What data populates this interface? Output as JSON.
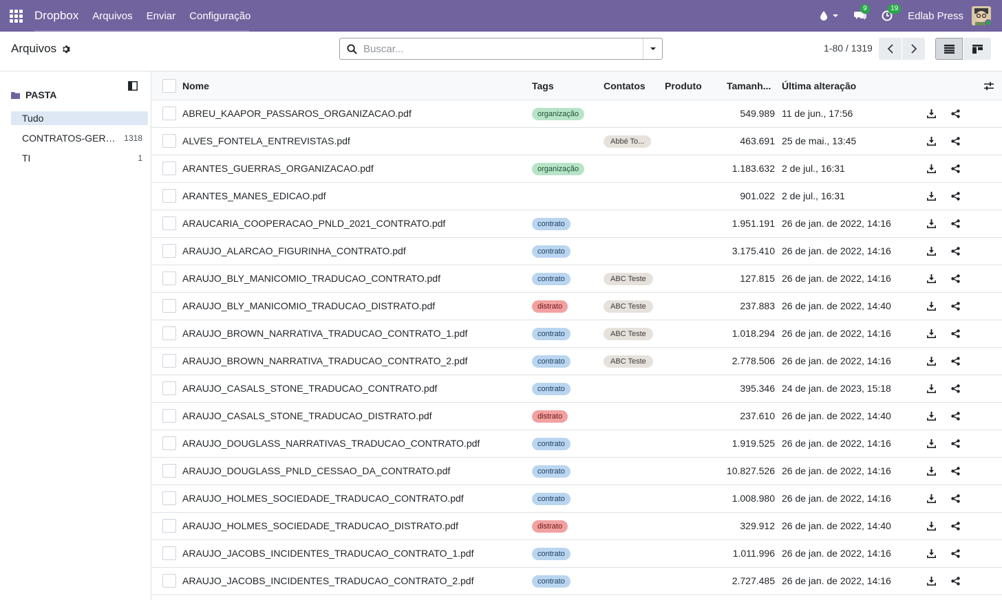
{
  "navbar": {
    "brand": "Dropbox",
    "menu": [
      "Arquivos",
      "Enviar",
      "Configuração"
    ],
    "messages_badge": "9",
    "activities_badge": "19",
    "username": "Edlab Press"
  },
  "control": {
    "title": "Arquivos",
    "search_placeholder": "Buscar...",
    "pager": "1-80 / 1319"
  },
  "sidebar": {
    "heading": "PASTA",
    "items": [
      {
        "label": "Tudo",
        "count": ""
      },
      {
        "label": "CONTRATOS-GERAIS",
        "count": "1318"
      },
      {
        "label": "TI",
        "count": "1"
      }
    ]
  },
  "table": {
    "headers": {
      "name": "Nome",
      "tags": "Tags",
      "contacts": "Contatos",
      "product": "Produto",
      "size": "Tamanh...",
      "modified": "Última alteração"
    },
    "rows": [
      {
        "name": "ABREU_KAAPOR_PASSAROS_ORGANIZACAO.pdf",
        "tag": "organização",
        "tag_color": "green",
        "contact": "",
        "size": "549.989",
        "date": "11 de jun., 17:56"
      },
      {
        "name": "ALVES_FONTELA_ENTREVISTAS.pdf",
        "tag": "",
        "tag_color": "",
        "contact": "Abbé To...",
        "size": "463.691",
        "date": "25 de mai., 13:45"
      },
      {
        "name": "ARANTES_GUERRAS_ORGANIZACAO.pdf",
        "tag": "organização",
        "tag_color": "green",
        "contact": "",
        "size": "1.183.632",
        "date": "2 de jul., 16:31"
      },
      {
        "name": "ARANTES_MANES_EDICAO.pdf",
        "tag": "",
        "tag_color": "",
        "contact": "",
        "size": "901.022",
        "date": "2 de jul., 16:31"
      },
      {
        "name": "ARAUCARIA_COOPERACAO_PNLD_2021_CONTRATO.pdf",
        "tag": "contrato",
        "tag_color": "blue",
        "contact": "",
        "size": "1.951.191",
        "date": "26 de jan. de 2022, 14:16"
      },
      {
        "name": "ARAUJO_ALARCAO_FIGURINHA_CONTRATO.pdf",
        "tag": "contrato",
        "tag_color": "blue",
        "contact": "",
        "size": "3.175.410",
        "date": "26 de jan. de 2022, 14:16"
      },
      {
        "name": "ARAUJO_BLY_MANICOMIO_TRADUCAO_CONTRATO.pdf",
        "tag": "contrato",
        "tag_color": "blue",
        "contact": "ABC Teste",
        "size": "127.815",
        "date": "26 de jan. de 2022, 14:16"
      },
      {
        "name": "ARAUJO_BLY_MANICOMIO_TRADUCAO_DISTRATO.pdf",
        "tag": "distrato",
        "tag_color": "red",
        "contact": "ABC Teste",
        "size": "237.883",
        "date": "26 de jan. de 2022, 14:40"
      },
      {
        "name": "ARAUJO_BROWN_NARRATIVA_TRADUCAO_CONTRATO_1.pdf",
        "tag": "contrato",
        "tag_color": "blue",
        "contact": "ABC Teste",
        "size": "1.018.294",
        "date": "26 de jan. de 2022, 14:16"
      },
      {
        "name": "ARAUJO_BROWN_NARRATIVA_TRADUCAO_CONTRATO_2.pdf",
        "tag": "contrato",
        "tag_color": "blue",
        "contact": "ABC Teste",
        "size": "2.778.506",
        "date": "26 de jan. de 2022, 14:16"
      },
      {
        "name": "ARAUJO_CASALS_STONE_TRADUCAO_CONTRATO.pdf",
        "tag": "contrato",
        "tag_color": "blue",
        "contact": "",
        "size": "395.346",
        "date": "24 de jan. de 2023, 15:18"
      },
      {
        "name": "ARAUJO_CASALS_STONE_TRADUCAO_DISTRATO.pdf",
        "tag": "distrato",
        "tag_color": "red",
        "contact": "",
        "size": "237.610",
        "date": "26 de jan. de 2022, 14:40"
      },
      {
        "name": "ARAUJO_DOUGLASS_NARRATIVAS_TRADUCAO_CONTRATO.pdf",
        "tag": "contrato",
        "tag_color": "blue",
        "contact": "",
        "size": "1.919.525",
        "date": "26 de jan. de 2022, 14:16"
      },
      {
        "name": "ARAUJO_DOUGLASS_PNLD_CESSAO_DA_CONTRATO.pdf",
        "tag": "contrato",
        "tag_color": "blue",
        "contact": "",
        "size": "10.827.526",
        "date": "26 de jan. de 2022, 14:16"
      },
      {
        "name": "ARAUJO_HOLMES_SOCIEDADE_TRADUCAO_CONTRATO.pdf",
        "tag": "contrato",
        "tag_color": "blue",
        "contact": "",
        "size": "1.008.980",
        "date": "26 de jan. de 2022, 14:16"
      },
      {
        "name": "ARAUJO_HOLMES_SOCIEDADE_TRADUCAO_DISTRATO.pdf",
        "tag": "distrato",
        "tag_color": "red",
        "contact": "",
        "size": "329.912",
        "date": "26 de jan. de 2022, 14:40"
      },
      {
        "name": "ARAUJO_JACOBS_INCIDENTES_TRADUCAO_CONTRATO_1.pdf",
        "tag": "contrato",
        "tag_color": "blue",
        "contact": "",
        "size": "1.011.996",
        "date": "26 de jan. de 2022, 14:16"
      },
      {
        "name": "ARAUJO_JACOBS_INCIDENTES_TRADUCAO_CONTRATO_2.pdf",
        "tag": "contrato",
        "tag_color": "blue",
        "contact": "",
        "size": "2.727.485",
        "date": "26 de jan. de 2022, 14:16"
      }
    ]
  },
  "icons": {
    "apps": "apps-grid-icon",
    "search": "search-icon",
    "download": "download-icon",
    "share": "share-icon"
  },
  "colors": {
    "navbar": "#71639e",
    "tag_green": "#b7e4c7",
    "tag_blue": "#b9d5f0",
    "tag_red": "#f2a1a1"
  }
}
